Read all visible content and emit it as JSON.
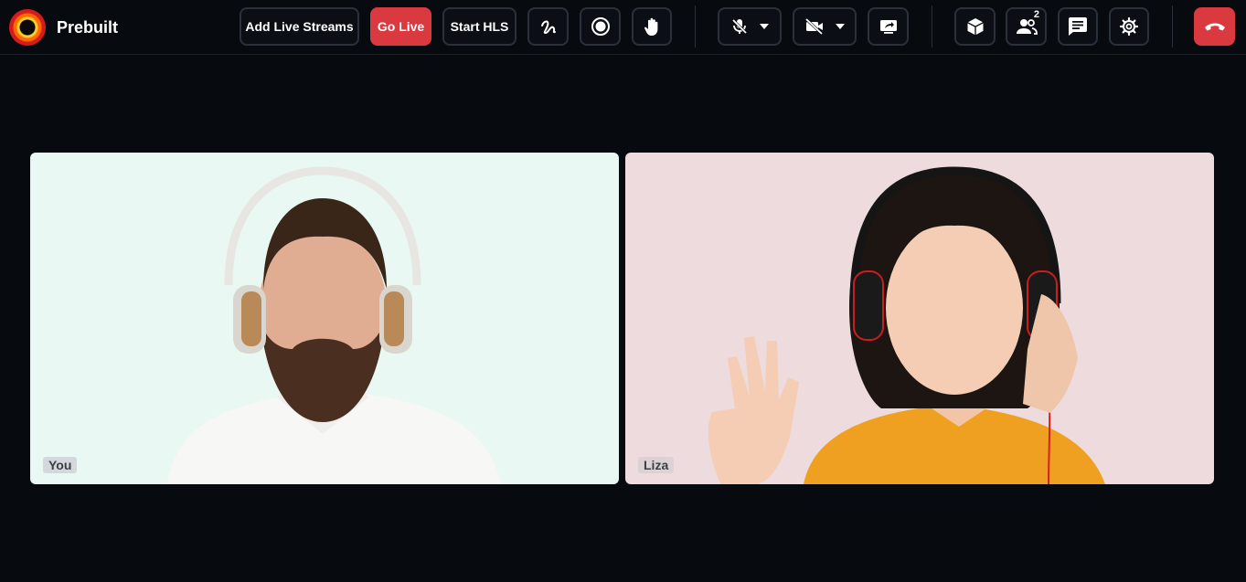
{
  "app": {
    "name": "Prebuilt"
  },
  "toolbar": {
    "add_live_streams": "Add Live Streams",
    "go_live": "Go Live",
    "start_hls": "Start HLS",
    "participants_count": "2"
  },
  "colors": {
    "background": "#070a0f",
    "button_border": "#2b313b",
    "danger": "#d9393f",
    "tile_you_bg": "#e9f8f2",
    "tile_liza_bg": "#eddbdd"
  },
  "participants": [
    {
      "label": "You"
    },
    {
      "label": "Liza"
    }
  ],
  "icons": {
    "whiteboard": "squiggle-icon",
    "record": "record-icon",
    "raise_hand": "hand-icon",
    "mic": "mic-off-icon",
    "camera": "video-off-icon",
    "screenshare": "screen-share-icon",
    "apps": "cube-icon",
    "participants": "people-icon",
    "chat": "chat-icon",
    "settings": "gear-icon",
    "leave": "hang-up-icon"
  }
}
